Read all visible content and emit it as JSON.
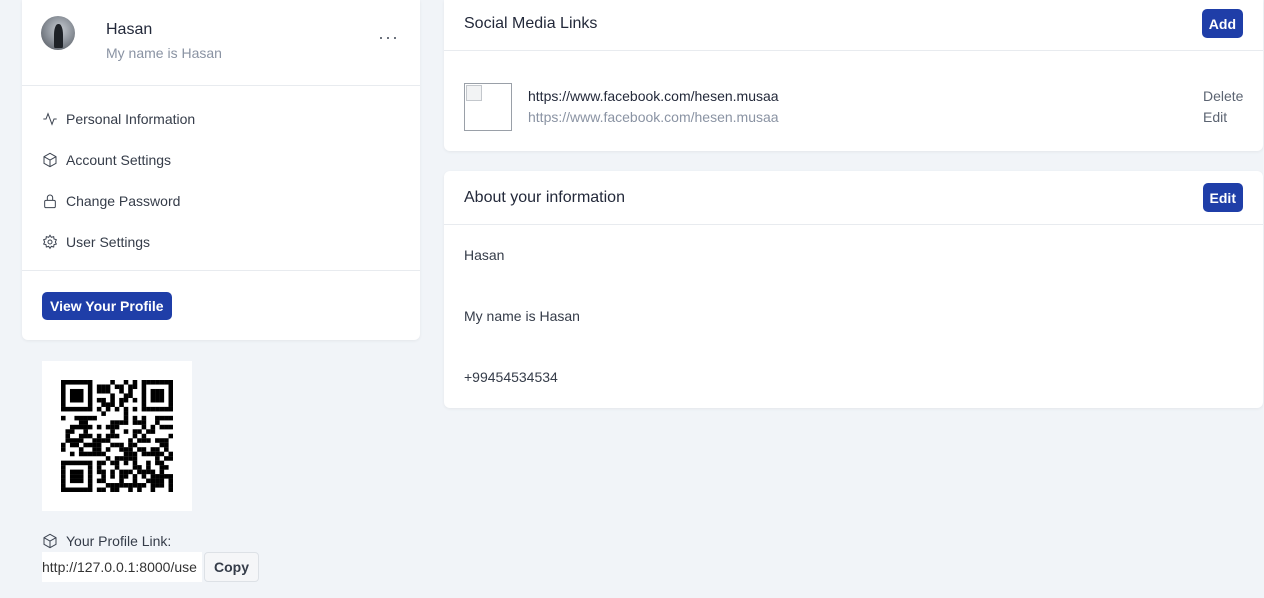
{
  "profile": {
    "name": "Hasan",
    "bio": "My name is Hasan",
    "more_label": "···"
  },
  "menu": [
    {
      "label": "Personal Information",
      "icon": "activity-icon"
    },
    {
      "label": "Account Settings",
      "icon": "box-icon"
    },
    {
      "label": "Change Password",
      "icon": "lock-icon"
    },
    {
      "label": "User Settings",
      "icon": "gear-icon"
    }
  ],
  "view_profile_label": "View Your Profile",
  "profile_link": {
    "label": "Your Profile Link:",
    "value": "http://127.0.0.1:8000/use",
    "copy_label": "Copy"
  },
  "social": {
    "title": "Social Media Links",
    "add_label": "Add",
    "items": [
      {
        "url": "https://www.facebook.com/hesen.musaa",
        "url_secondary": "https://www.facebook.com/hesen.musaa",
        "delete_label": "Delete",
        "edit_label": "Edit"
      }
    ]
  },
  "about": {
    "title": "About your information",
    "edit_label": "Edit",
    "name": "Hasan",
    "bio": "My name is Hasan",
    "phone": "+99454534534"
  },
  "colors": {
    "primary": "#1f3ea8",
    "background": "#f1f4f8",
    "muted_text": "#8a93a3"
  }
}
